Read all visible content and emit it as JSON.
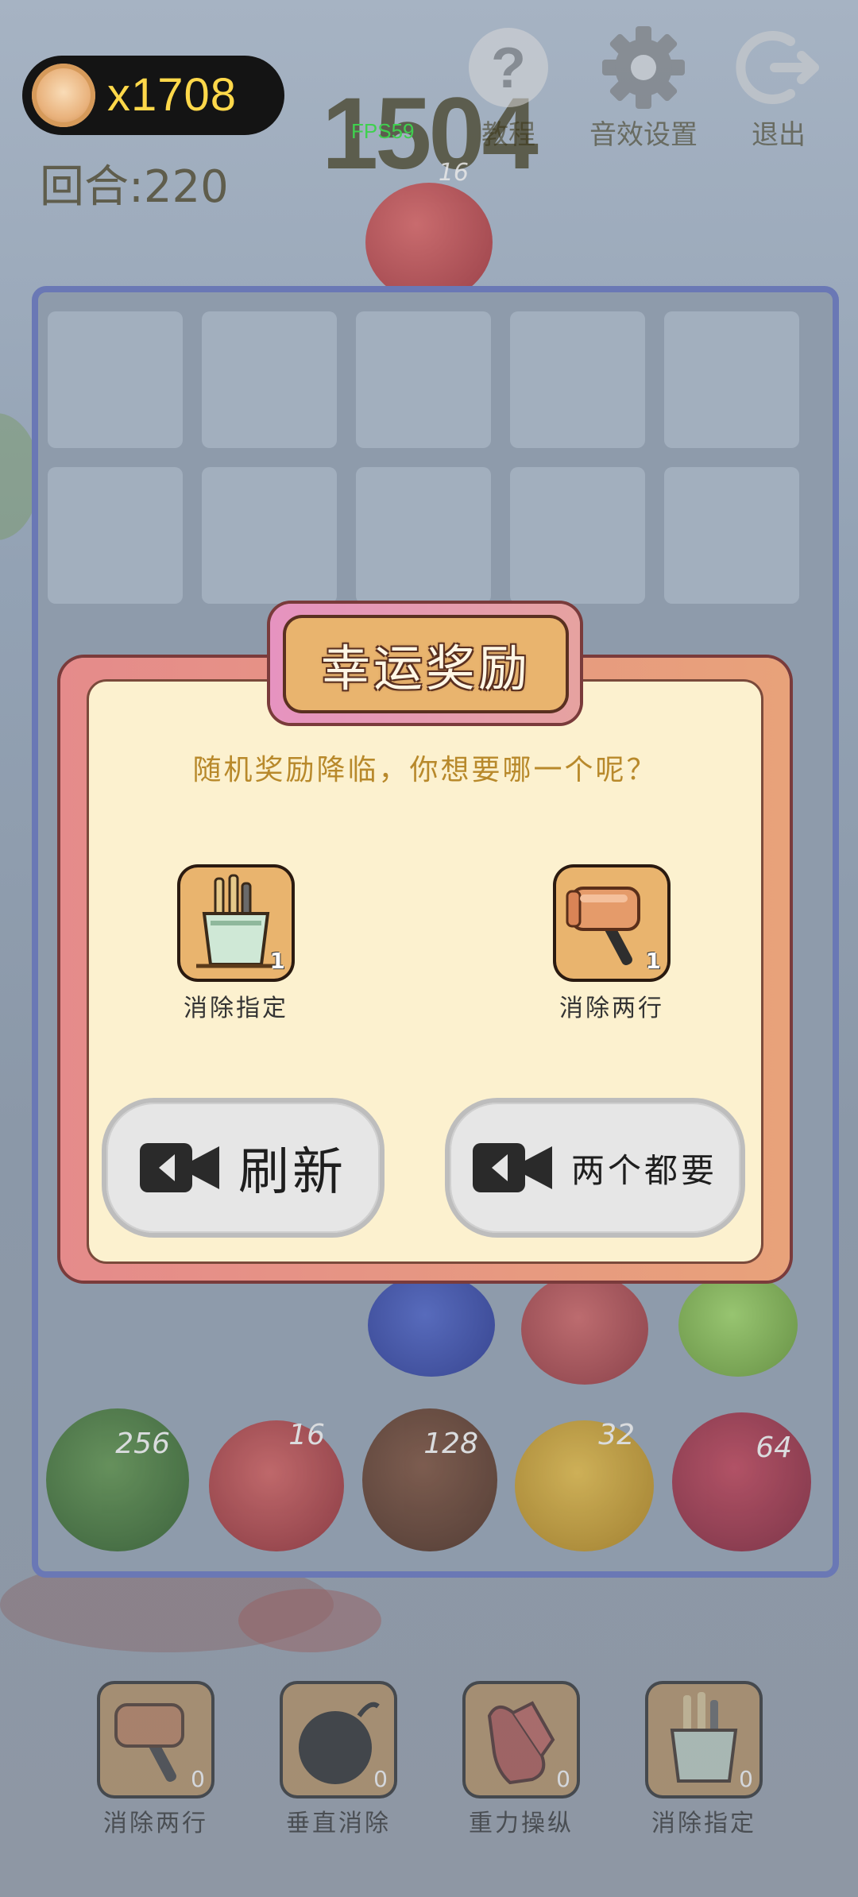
{
  "hud": {
    "coins": "x1708",
    "round": "回合:220",
    "score": "1504",
    "fps": "FPS59"
  },
  "top_buttons": [
    {
      "label": "教程",
      "icon": "question-icon"
    },
    {
      "label": "音效设置",
      "icon": "gear-icon"
    },
    {
      "label": "退出",
      "icon": "exit-icon"
    }
  ],
  "next_fruit": {
    "value": "16"
  },
  "board_fruits": [
    {
      "value": "256",
      "kind": "watermelon"
    },
    {
      "value": "16",
      "kind": "apple"
    },
    {
      "value": "128",
      "kind": "coconut"
    },
    {
      "value": "32",
      "kind": "orange"
    },
    {
      "value": "64",
      "kind": "dragonfruit"
    }
  ],
  "modal": {
    "title": "幸运奖励",
    "prompt": "随机奖励降临，你想要哪一个呢？",
    "rewards": [
      {
        "label": "消除指定",
        "count": "1",
        "icon": "bucket-icon"
      },
      {
        "label": "消除两行",
        "count": "1",
        "icon": "hammer-icon"
      }
    ],
    "refresh_label": "刷新",
    "both_label": "两个都要"
  },
  "toolbar": [
    {
      "label": "消除两行",
      "count": "0",
      "icon": "hammer-icon"
    },
    {
      "label": "垂直消除",
      "count": "0",
      "icon": "bomb-icon"
    },
    {
      "label": "重力操纵",
      "count": "0",
      "icon": "glove-icon"
    },
    {
      "label": "消除指定",
      "count": "0",
      "icon": "bucket-icon"
    }
  ],
  "colors": {
    "coin_text": "#ffd84a",
    "modal_bg": "#fcf1cf",
    "title_plate": "#e9b46e",
    "prompt": "#b8892b"
  }
}
